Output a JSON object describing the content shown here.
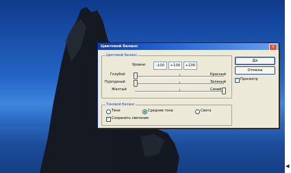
{
  "dialog": {
    "title": "Цветовой баланс",
    "close_glyph": "×"
  },
  "color_balance": {
    "group_label": "Цветовой баланс",
    "levels_label": "Уровни:",
    "levels": [
      "-100",
      "+100",
      "+100"
    ],
    "sliders": [
      {
        "left": "Голубой",
        "right": "Красный",
        "value": -100
      },
      {
        "left": "Пурпурный",
        "right": "Зеленый",
        "value": -100
      },
      {
        "left": "Желтый",
        "right": "Синий",
        "value": 100
      }
    ]
  },
  "tone_balance": {
    "group_label": "Тоновой баланс",
    "options": [
      "Тени",
      "Средние тона",
      "Света"
    ],
    "selected": "Средние тона",
    "preserve_label": "Сохранить свечение",
    "preserve_checked": true
  },
  "buttons": {
    "ok": "Да",
    "cancel": "Отмена"
  },
  "preview": {
    "label": "Просмотр",
    "checked": true,
    "check_glyph": "✓"
  },
  "page": {
    "edge_glyph": "◂"
  }
}
